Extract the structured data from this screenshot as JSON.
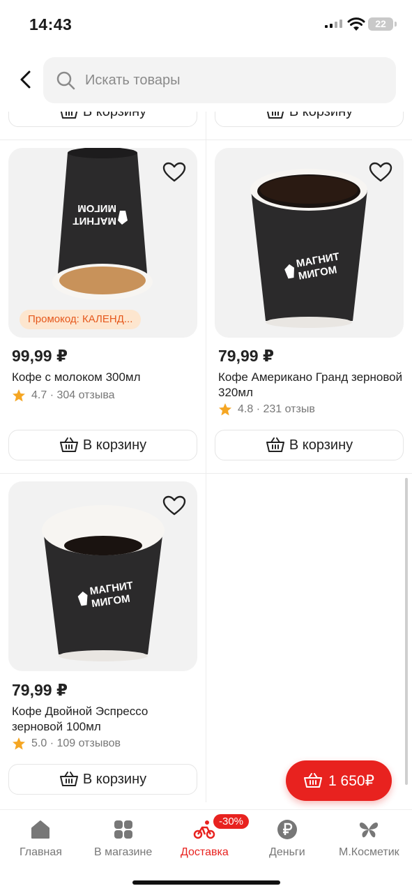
{
  "status": {
    "time": "14:43",
    "battery": "22"
  },
  "search": {
    "placeholder": "Искать товары"
  },
  "add_to_cart_label": "В корзину",
  "products": [
    {
      "price": "99,99 ₽",
      "name": "Кофе с молоком 300мл",
      "rating": "4.7",
      "reviews": "304 отзыва",
      "promo": "Промокод: КАЛЕНД..."
    },
    {
      "price": "79,99 ₽",
      "name": "Кофе Американо Гранд зерновой 320мл",
      "rating": "4.8",
      "reviews": "231 отзыв"
    },
    {
      "price": "79,99 ₽",
      "name": "Кофе Двойной Эспрессо зерновой 100мл",
      "rating": "5.0",
      "reviews": "109 отзывов"
    }
  ],
  "cup_logo": [
    "МАГНИТ",
    "МИГОМ"
  ],
  "cart": {
    "total": "1 650₽"
  },
  "nav": {
    "items": [
      {
        "label": "Главная",
        "icon": "home-icon"
      },
      {
        "label": "В магазине",
        "icon": "grid-icon"
      },
      {
        "label": "Доставка",
        "icon": "bike-icon",
        "badge": "-30%"
      },
      {
        "label": "Деньги",
        "icon": "ruble-icon"
      },
      {
        "label": "М.Косметик",
        "icon": "butterfly-icon"
      }
    ]
  },
  "colors": {
    "accent": "#e8221f",
    "promo_bg": "#fde6cf",
    "promo_text": "#e5581c",
    "star": "#f5a623"
  }
}
